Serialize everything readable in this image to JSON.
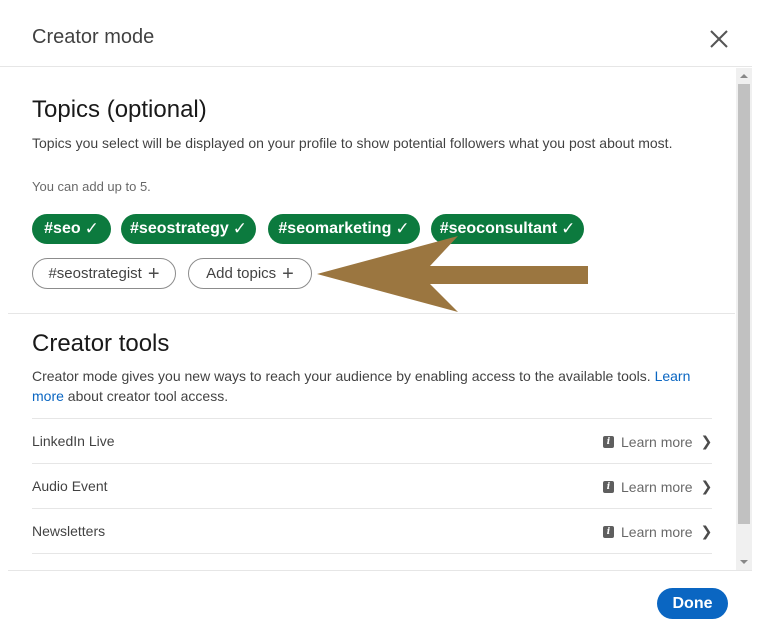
{
  "modal": {
    "title": "Creator mode"
  },
  "topics": {
    "title": "Topics (optional)",
    "description": "Topics you select will be displayed on your profile to show potential followers what you post about most.",
    "limit_note": "You can add up to 5.",
    "selected": [
      {
        "label": "#seo",
        "check": "✓"
      },
      {
        "label": "#seostrategy",
        "check": "✓"
      },
      {
        "label": "#seomarketing",
        "check": "✓"
      },
      {
        "label": "#seoconsultant",
        "check": "✓"
      }
    ],
    "suggested": [
      {
        "label": "#seostrategist",
        "plus": "+"
      }
    ],
    "add_topics_label": "Add topics",
    "add_plus": "+"
  },
  "creator_tools": {
    "title": "Creator tools",
    "description_before": "Creator mode gives you new ways to reach your audience by enabling access to the available tools. ",
    "learn_more_link": "Learn more",
    "description_after": " about creator tool access.",
    "items": [
      {
        "label": "LinkedIn Live",
        "action": "Learn more"
      },
      {
        "label": "Audio Event",
        "action": "Learn more"
      },
      {
        "label": "Newsletters",
        "action": "Learn more"
      }
    ]
  },
  "footer": {
    "done_label": "Done"
  },
  "colors": {
    "topic_pill_bg": "#0c7a3e",
    "primary_button": "#0a66c2",
    "link": "#0a66c2",
    "annotation_arrow": "#9b7640"
  },
  "icons": {
    "close": "close-icon",
    "info": "info-icon",
    "chevron": "chevron-right-icon",
    "check": "check-icon",
    "plus": "plus-icon"
  }
}
